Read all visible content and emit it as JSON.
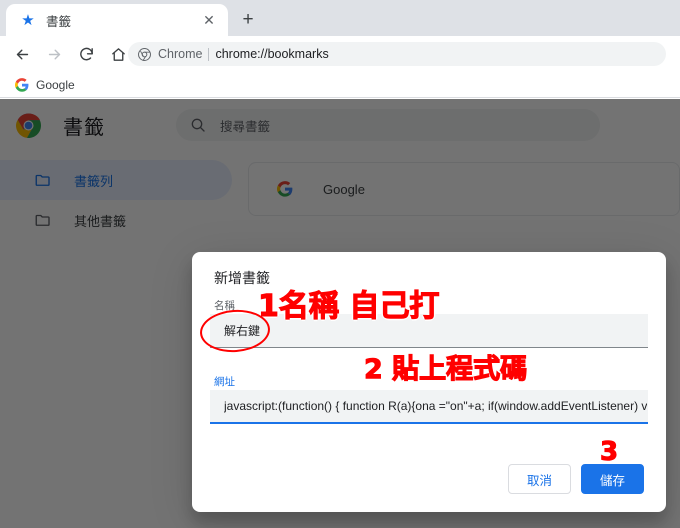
{
  "browser": {
    "tab": {
      "title": "書籤",
      "favicon_icon": "star-icon",
      "close_icon": "close-icon"
    },
    "newtab_label": "+",
    "nav": {
      "back_icon": "arrow-back-icon",
      "forward_icon": "arrow-forward-icon",
      "reload_icon": "reload-icon",
      "home_icon": "home-icon"
    },
    "omnibox": {
      "icon": "chrome-icon",
      "chip": "Chrome",
      "url": "chrome://bookmarks"
    },
    "bookmarks_bar": [
      {
        "icon": "google-icon",
        "label": "Google"
      }
    ]
  },
  "bookmarks_page": {
    "logo_icon": "chrome-logo-icon",
    "title": "書籤",
    "search": {
      "icon": "search-icon",
      "placeholder": "搜尋書籤",
      "value": ""
    },
    "sidebar": [
      {
        "icon": "folder-icon",
        "label": "書籤列",
        "active": true
      },
      {
        "icon": "folder-icon",
        "label": "其他書籤",
        "active": false
      }
    ],
    "items": [
      {
        "icon": "google-icon",
        "label": "Google"
      }
    ]
  },
  "dialog": {
    "title": "新增書籤",
    "name_field": {
      "label": "名稱",
      "value": "解右鍵",
      "focused": false
    },
    "url_field": {
      "label": "網址",
      "value": "javascript:(function() { function R(a){ona =\"on\"+a; if(window.addEventListener) v",
      "focused": true
    },
    "cancel_label": "取消",
    "save_label": "儲存"
  },
  "annotations": [
    {
      "id": 1,
      "text": "1名稱  自己打"
    },
    {
      "id": 2,
      "text": "2  貼上程式碼"
    },
    {
      "id": 3,
      "text": "3"
    }
  ],
  "colors": {
    "accent_blue": "#1a73e8",
    "annotation_red": "#ff0000",
    "tabstrip_grey": "#dee1e6",
    "field_grey": "#f1f3f4"
  }
}
